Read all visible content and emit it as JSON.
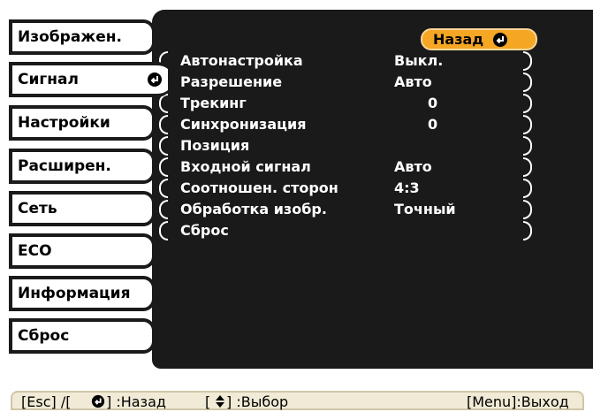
{
  "tabs": [
    {
      "label": "Изображен.",
      "active": false
    },
    {
      "label": "Сигнал",
      "active": true
    },
    {
      "label": "Настройки",
      "active": false
    },
    {
      "label": "Расширен.",
      "active": false
    },
    {
      "label": "Сеть",
      "active": false
    },
    {
      "label": "ECO",
      "active": false
    },
    {
      "label": "Информация",
      "active": false
    },
    {
      "label": "Сброс",
      "active": false
    }
  ],
  "panel": {
    "back_label": "Назад",
    "rows": [
      {
        "name": "Автонастройка",
        "value": "Выкл."
      },
      {
        "name": "Разрешение",
        "value": "Авто"
      },
      {
        "name": "Трекинг",
        "value": "0"
      },
      {
        "name": "Синхронизация",
        "value": "0"
      },
      {
        "name": "Позиция",
        "value": ""
      },
      {
        "name": "Входной сигнал",
        "value": "Авто"
      },
      {
        "name": "Соотношен. сторон",
        "value": "4:3"
      },
      {
        "name": "Обработка изобр.",
        "value": "Точный"
      },
      {
        "name": "Сброс",
        "value": ""
      }
    ]
  },
  "help": {
    "esc_prefix": "[Esc] /[",
    "esc_suffix": "] :Назад",
    "select_prefix": "[",
    "select_suffix": "] :Выбор",
    "exit": "[Menu]:Выход"
  },
  "colors": {
    "panel_bg": "#1a1a1a",
    "back_button": "#f5a623",
    "help_bg": "#f0ead6"
  },
  "icons": {
    "enter": "enter-icon",
    "updown": "updown-arrow-icon"
  }
}
